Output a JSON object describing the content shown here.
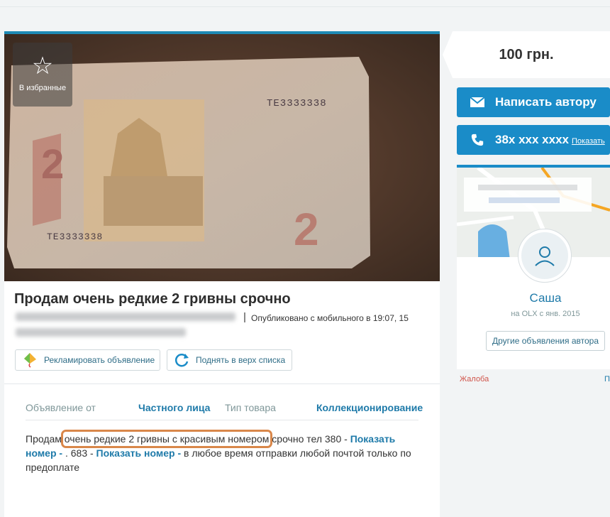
{
  "favorite": {
    "icon": "star-icon",
    "label": "В избранные"
  },
  "banknote": {
    "serial_top": "ТЕ3333338",
    "serial_bottom": "ТЕ3333338",
    "denomination": "2"
  },
  "ad": {
    "title": "Продам очень редкие 2 гривны срочно",
    "published": "Опубликовано с мобильного   в 19:07, 15"
  },
  "actions": {
    "promote_label": "Рекламировать объявление",
    "raise_label": "Поднять в верх списка"
  },
  "details": {
    "from_label": "Объявление от",
    "from_value": "Частного лица",
    "type_label": "Тип товара",
    "type_value": "Коллекционирование"
  },
  "description": {
    "part1": "Продам ",
    "highlighted": "очень редкие 2 гривны с красивым номером",
    "part2": " срочно тел 380 - ",
    "show_number_1": "Показать номер -",
    "part3": " . 683 - ",
    "show_number_2": "Показать номер -",
    "part4": " в любое время отправки любой почтой только по предоплате"
  },
  "sidebar": {
    "price": "100 грн.",
    "write_label": "Написать автору",
    "phone_label": "38x xxx xxxx",
    "phone_show": "Показать",
    "seller_name": "Саша",
    "seller_since": "на OLX с янв. 2015",
    "other_ads": "Другие объявления автора",
    "complaint": "Жалоба",
    "cut_text": "П"
  },
  "colors": {
    "accent": "#1a8cc8",
    "highlight": "#d9874a",
    "complaint": "#d0544a"
  }
}
